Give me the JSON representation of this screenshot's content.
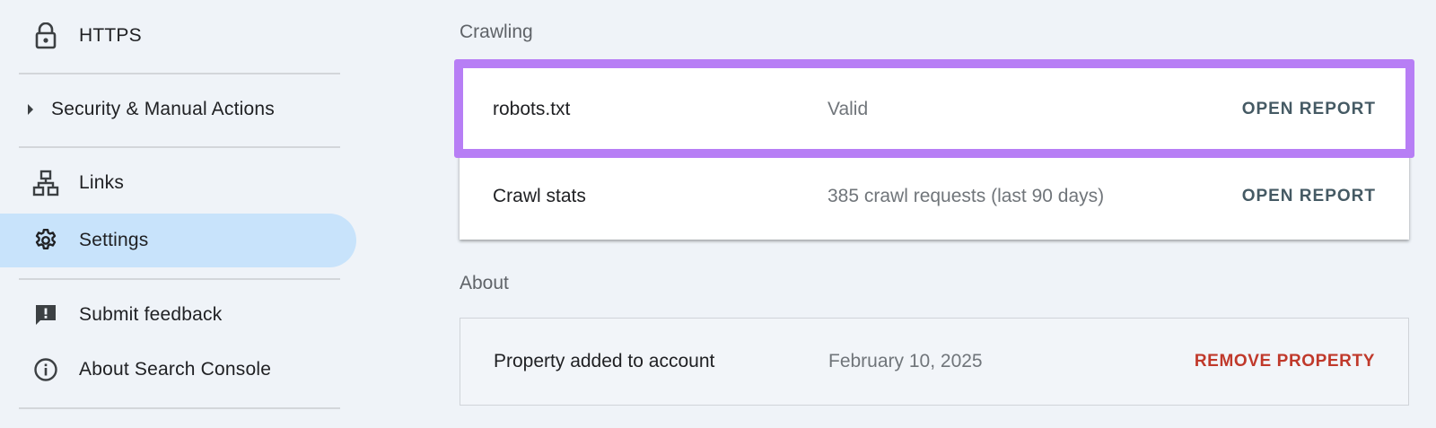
{
  "sidebar": {
    "items": [
      {
        "label": "HTTPS",
        "icon": "lock-icon"
      },
      {
        "label": "Security & Manual Actions",
        "icon": "caret-right-icon"
      },
      {
        "label": "Links",
        "icon": "links-icon"
      },
      {
        "label": "Settings",
        "icon": "gear-icon"
      },
      {
        "label": "Submit feedback",
        "icon": "feedback-icon"
      },
      {
        "label": "About Search Console",
        "icon": "info-icon"
      }
    ]
  },
  "crawling": {
    "title": "Crawling",
    "rows": [
      {
        "name": "robots.txt",
        "value": "Valid",
        "action": "OPEN REPORT"
      },
      {
        "name": "Crawl stats",
        "value": "385 crawl requests (last 90 days)",
        "action": "OPEN REPORT"
      }
    ]
  },
  "about": {
    "title": "About",
    "rows": [
      {
        "name": "Property added to account",
        "value": "February 10, 2025",
        "action": "REMOVE PROPERTY"
      }
    ]
  },
  "colors": {
    "background": "#eff3f8",
    "selected_nav": "#c8e3fb",
    "highlight_border": "#b77ef5",
    "danger_action": "#c0392b",
    "action_text": "#455a64"
  }
}
